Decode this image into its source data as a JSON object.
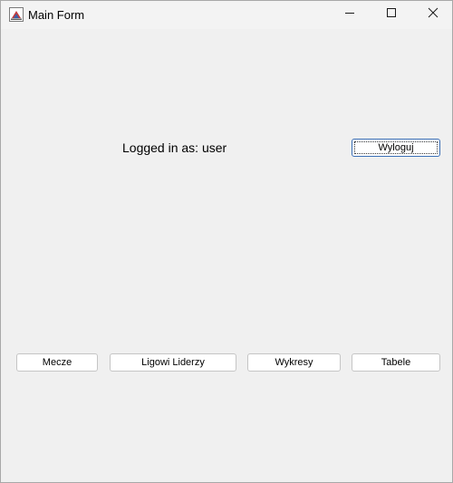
{
  "window": {
    "title": "Main Form",
    "icon": "java-app-icon",
    "controls": {
      "minimize_icon": "minimize-icon",
      "maximize_icon": "maximize-icon",
      "close_icon": "close-icon"
    }
  },
  "main": {
    "login_label": "Logged in as: user",
    "logout_label": "Wyloguj",
    "nav_buttons": [
      {
        "label": "Mecze"
      },
      {
        "label": "Ligowi Liderzy"
      },
      {
        "label": "Wykresy"
      },
      {
        "label": "Tabele"
      }
    ]
  },
  "colors": {
    "window_background": "#f0f0f0",
    "titlebar_background": "#f3f3f3",
    "button_background": "#ffffff",
    "button_border": "#c5c5c5",
    "focus_border": "#3b6fb6"
  }
}
